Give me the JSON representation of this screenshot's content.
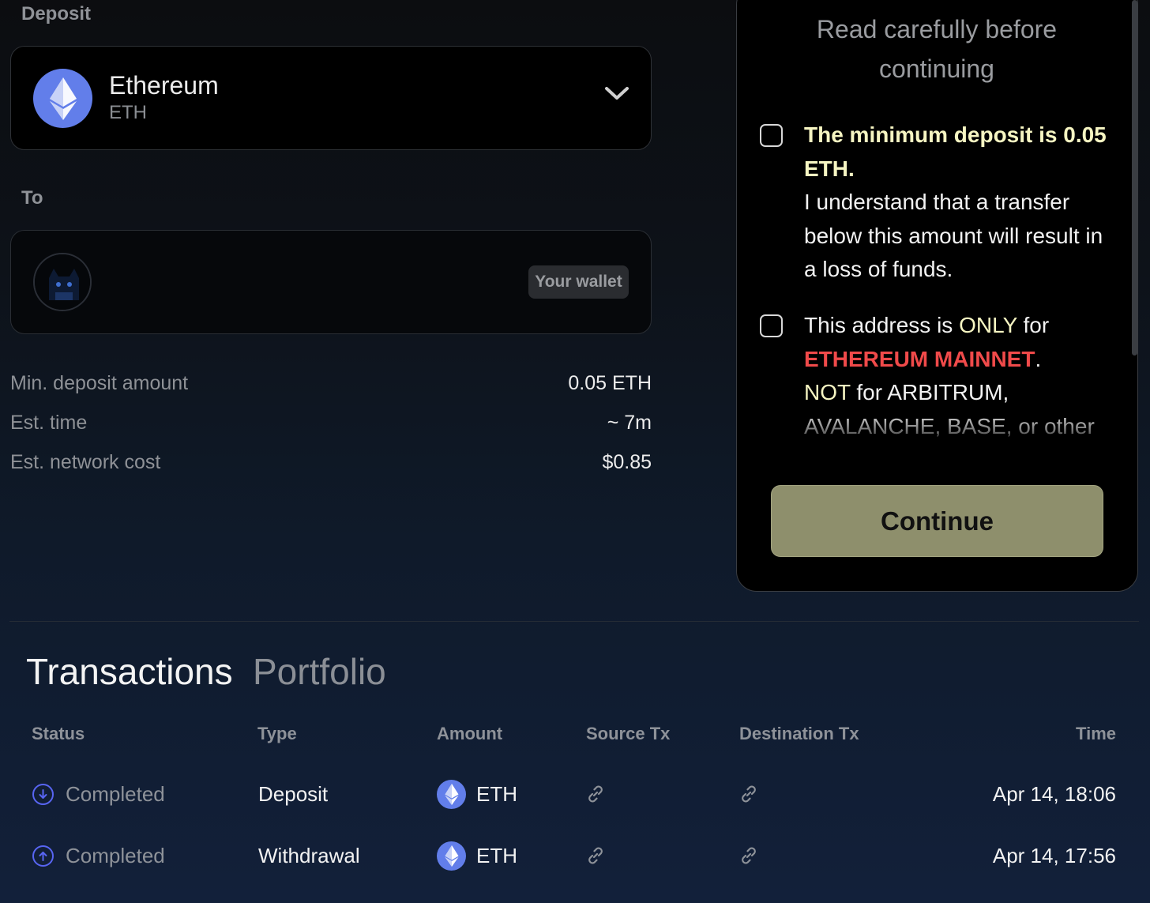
{
  "deposit": {
    "label": "Deposit",
    "token_name": "Ethereum",
    "token_symbol": "ETH",
    "token_icon": "ethereum-icon",
    "dropdown_icon": "chevron-down-icon"
  },
  "to": {
    "label": "To",
    "wallet_badge": "Your wallet",
    "avatar_icon": "cat-avatar"
  },
  "info": {
    "min_deposit_label": "Min. deposit amount",
    "min_deposit_value": "0.05 ETH",
    "est_time_label": "Est. time",
    "est_time_value": "~ 7m",
    "est_cost_label": "Est. network cost",
    "est_cost_value": "$0.85"
  },
  "modal": {
    "title": "Read carefully before continuing",
    "clause1_bold": "The minimum deposit is 0.05 ETH.",
    "clause1_text": "I understand that a transfer below this amount will result in a loss of funds.",
    "clause2_pre": "This address is ",
    "clause2_only": "ONLY",
    "clause2_for": " for",
    "clause2_network": "ETHEREUM MAINNET",
    "clause2_dot": ".",
    "clause2_not": "NOT",
    "clause2_rest": " for ARBITRUM, AVALANCHE, BASE, or other",
    "continue_label": "Continue"
  },
  "tabs": [
    {
      "label": "Transactions",
      "active": true
    },
    {
      "label": "Portfolio",
      "active": false
    }
  ],
  "table": {
    "headers": [
      "Status",
      "Type",
      "Amount",
      "Source Tx",
      "Destination Tx",
      "Time"
    ],
    "rows": [
      {
        "status": "Completed",
        "status_icon": "arrow-down-circle-icon",
        "type": "Deposit",
        "amount": "ETH",
        "time": "Apr 14, 18:06"
      },
      {
        "status": "Completed",
        "status_icon": "arrow-up-circle-icon",
        "type": "Withdrawal",
        "amount": "ETH",
        "time": "Apr 14, 17:56"
      }
    ]
  },
  "colors": {
    "accent_yellow": "#f6f5c2",
    "warning_red": "#f04a4a",
    "button_olive": "#8e8f6c",
    "eth_blue": "#627eea",
    "status_icon_blue": "#5865f2"
  }
}
